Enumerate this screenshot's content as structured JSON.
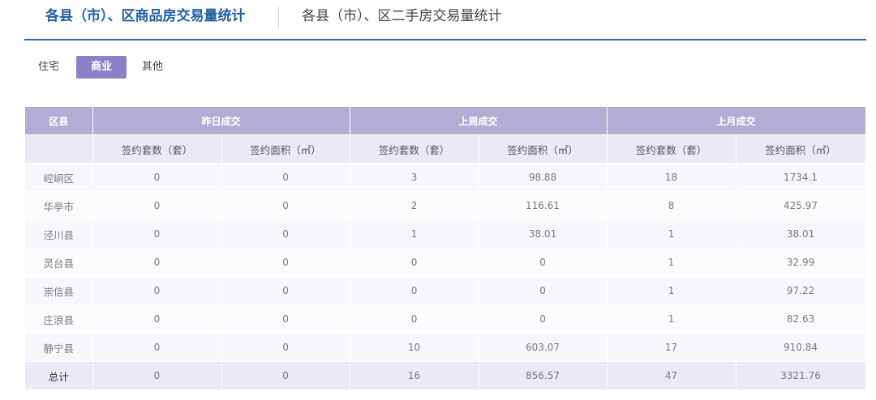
{
  "header": {
    "active_tab": "各县（市）、区商品房交易量统计",
    "inactive_tab": "各县（市）、区二手房交易量统计"
  },
  "subtabs": [
    "住宅",
    "商业",
    "其他"
  ],
  "active_subtab": "商业",
  "colors": {
    "accent_blue": "#2361a3",
    "header_purple": "#b5acd6",
    "active_subtab_bg": "#8e80c8",
    "subheader_bg": "#ebe9f6"
  },
  "table": {
    "region_header": "区县",
    "group_headers": [
      "昨日成交",
      "上周成交",
      "上月成交"
    ],
    "sub_headers": [
      "签约套数（套）",
      "签约面积（㎡）",
      "签约套数（套）",
      "签约面积（㎡）",
      "签约套数（套）",
      "签约面积（㎡）"
    ],
    "rows": [
      {
        "name": "崆峒区",
        "values": [
          "0",
          "0",
          "3",
          "98.88",
          "18",
          "1734.1"
        ]
      },
      {
        "name": "华亭市",
        "values": [
          "0",
          "0",
          "2",
          "116.61",
          "8",
          "425.97"
        ]
      },
      {
        "name": "泾川县",
        "values": [
          "0",
          "0",
          "1",
          "38.01",
          "1",
          "38.01"
        ]
      },
      {
        "name": "灵台县",
        "values": [
          "0",
          "0",
          "0",
          "0",
          "1",
          "32.99"
        ]
      },
      {
        "name": "崇信县",
        "values": [
          "0",
          "0",
          "0",
          "0",
          "1",
          "97.22"
        ]
      },
      {
        "name": "庄浪县",
        "values": [
          "0",
          "0",
          "0",
          "0",
          "1",
          "82.63"
        ]
      },
      {
        "name": "静宁县",
        "values": [
          "0",
          "0",
          "10",
          "603.07",
          "17",
          "910.84"
        ]
      }
    ],
    "total": {
      "name": "总计",
      "values": [
        "0",
        "0",
        "16",
        "856.57",
        "47",
        "3321.76"
      ]
    }
  }
}
